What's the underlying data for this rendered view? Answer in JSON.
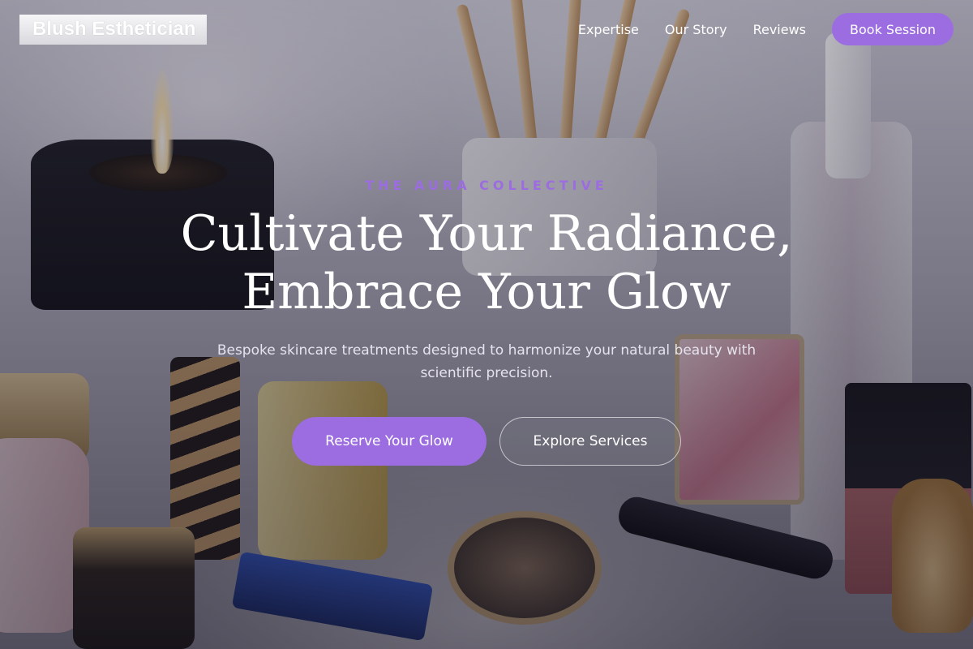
{
  "nav": {
    "brand": "Blush Esthetician",
    "links": [
      "Expertise",
      "Our Story",
      "Reviews"
    ],
    "cta_label": "Book Session"
  },
  "hero": {
    "eyebrow": "THE AURA COLLECTIVE",
    "headline_line1": "Cultivate Your Radiance,",
    "headline_line2": "Embrace Your Glow",
    "subheadline": "Bespoke skincare treatments designed to harmonize your natural beauty with scientific precision.",
    "primary_cta": "Reserve Your Glow",
    "secondary_cta": "Explore Services"
  },
  "colors": {
    "accent": "#9b6de0",
    "text_on_dark": "#ffffff"
  }
}
